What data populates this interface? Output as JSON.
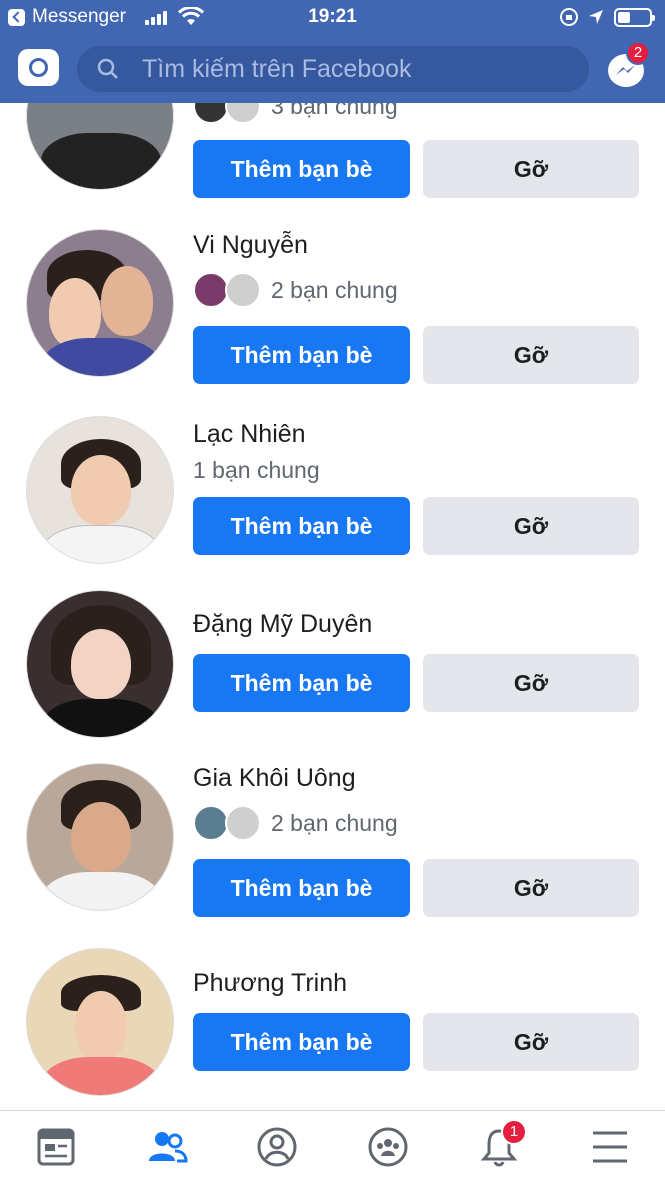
{
  "status_bar": {
    "back_app": "Messenger",
    "time": "19:21"
  },
  "header": {
    "search_placeholder": "Tìm kiếm trên Facebook",
    "messenger_badge": "2"
  },
  "colors": {
    "brand": "#4267b2",
    "primary_button": "#1877f2",
    "secondary_button": "#e4e6eb",
    "badge": "#e41e3f"
  },
  "suggestions": [
    {
      "name": "",
      "mutual_text": "3 bạn chung",
      "add_label": "Thêm bạn bè",
      "remove_label": "Gỡ",
      "mutual_avatars": 2
    },
    {
      "name": "Vi Nguyễn",
      "mutual_text": "2 bạn chung",
      "add_label": "Thêm bạn bè",
      "remove_label": "Gỡ",
      "mutual_avatars": 2
    },
    {
      "name": "Lạc Nhiên",
      "mutual_text": "1 bạn chung",
      "add_label": "Thêm bạn bè",
      "remove_label": "Gỡ",
      "mutual_avatars": 0
    },
    {
      "name": "Đặng Mỹ Duyên",
      "mutual_text": "",
      "add_label": "Thêm bạn bè",
      "remove_label": "Gỡ",
      "mutual_avatars": 0
    },
    {
      "name": "Gia Khôi Uông",
      "mutual_text": "2 bạn chung",
      "add_label": "Thêm bạn bè",
      "remove_label": "Gỡ",
      "mutual_avatars": 2
    },
    {
      "name": "Phương Trinh",
      "mutual_text": "",
      "add_label": "Thêm bạn bè",
      "remove_label": "Gỡ",
      "mutual_avatars": 0
    }
  ],
  "tab_bar": {
    "tabs": [
      "news-feed-icon",
      "friends-icon",
      "profile-icon",
      "groups-icon",
      "notifications-icon",
      "menu-icon"
    ],
    "active": "friends-icon",
    "notifications_badge": "1"
  }
}
